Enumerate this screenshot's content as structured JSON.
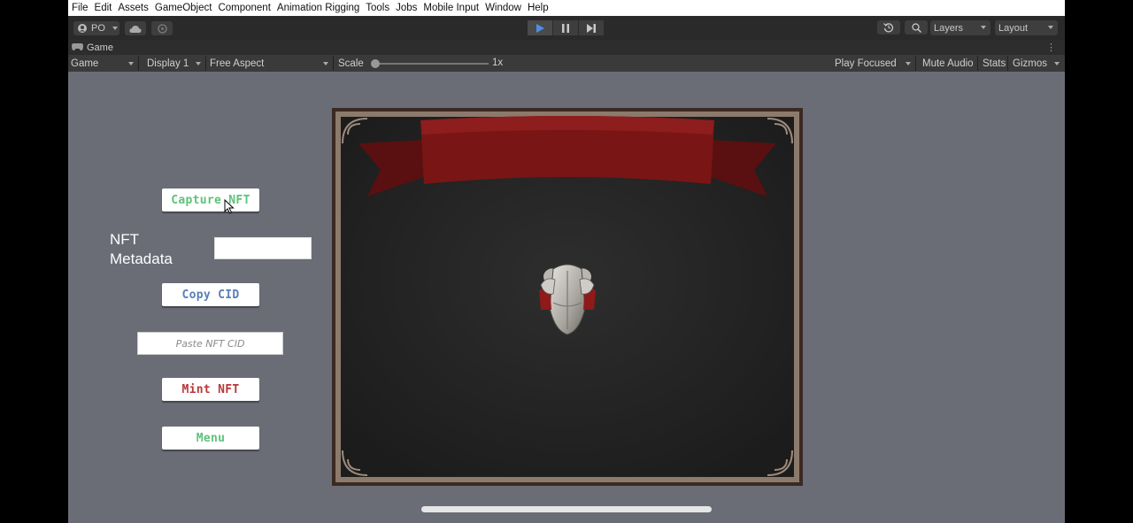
{
  "menu": [
    "File",
    "Edit",
    "Assets",
    "GameObject",
    "Component",
    "Animation Rigging",
    "Tools",
    "Jobs",
    "Mobile Input",
    "Window",
    "Help"
  ],
  "toolbar": {
    "account_label": "PO",
    "layers_label": "Layers",
    "layout_label": "Layout"
  },
  "tab": {
    "title": "Game"
  },
  "game_controls": {
    "view": "Game",
    "display": "Display 1",
    "aspect": "Free Aspect",
    "scale_label": "Scale",
    "scale_value": "1x",
    "play_mode": "Play Focused",
    "mute": "Mute Audio",
    "stats": "Stats",
    "gizmos": "Gizmos"
  },
  "game_ui": {
    "capture_label": "Capture NFT",
    "metadata_label": "NFT Metadata",
    "copy_label": "Copy CID",
    "cid_placeholder": "Paste NFT CID",
    "mint_label": "Mint NFT",
    "menu_label": "Menu"
  },
  "colors": {
    "game_background": "#6a6c76",
    "green_text": "#5fc27a",
    "blue_text": "#5a7fb8",
    "red_text": "#b8383a",
    "banner": "#7a1515"
  },
  "icons": [
    "account-icon",
    "cloud-icon",
    "collab-icon",
    "play-icon",
    "pause-icon",
    "step-icon",
    "history-icon",
    "search-icon",
    "gamepad-icon",
    "kebab-icon",
    "armor-icon",
    "cursor-icon"
  ]
}
